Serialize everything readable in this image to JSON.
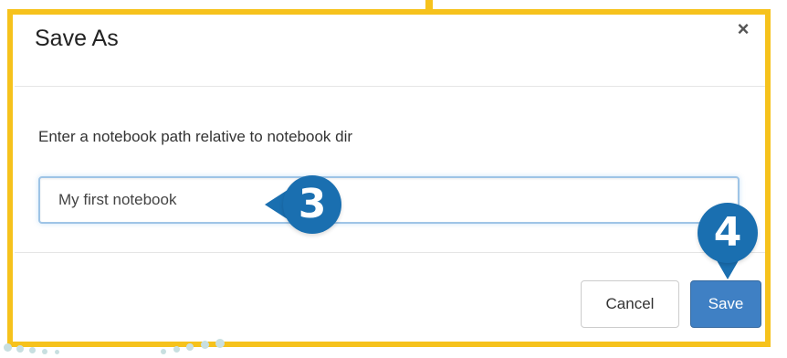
{
  "dialog": {
    "title": "Save As",
    "close_symbol": "×",
    "prompt": "Enter a notebook path relative to notebook dir",
    "path_value": "My first notebook",
    "cancel_label": "Cancel",
    "save_label": "Save"
  },
  "callouts": {
    "step_3": "3",
    "step_4": "4"
  },
  "colors": {
    "highlight_frame": "#f6c21c",
    "callout": "#1a6fb0",
    "primary_button": "#3f80c4",
    "input_focus_border": "#9ec4e6"
  }
}
